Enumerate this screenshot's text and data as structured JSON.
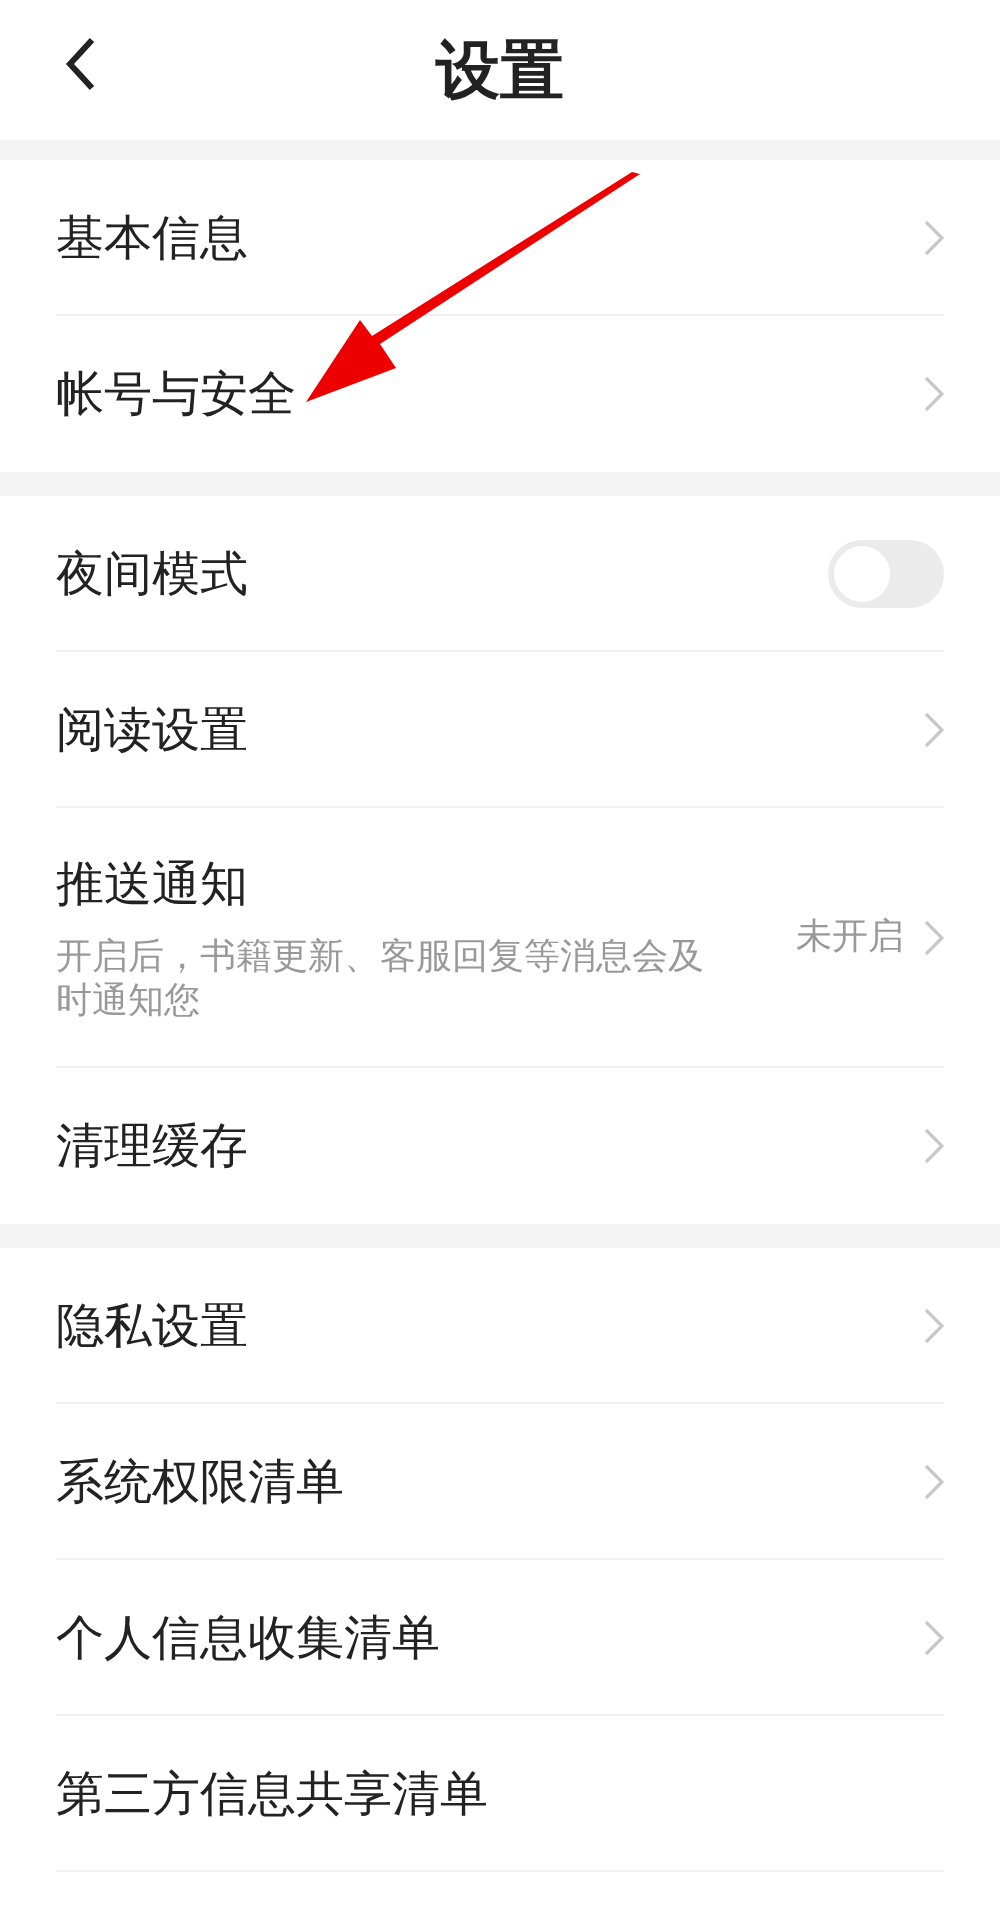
{
  "header": {
    "title": "设置"
  },
  "groups": [
    {
      "items": [
        {
          "kind": "link",
          "label": "基本信息",
          "chevron": true
        },
        {
          "kind": "link",
          "label": "帐号与安全",
          "chevron": true
        }
      ]
    },
    {
      "items": [
        {
          "kind": "toggle",
          "label": "夜间模式",
          "on": false
        },
        {
          "kind": "link",
          "label": "阅读设置",
          "chevron": true
        },
        {
          "kind": "detail",
          "label": "推送通知",
          "description": "开启后，书籍更新、客服回复等消息会及时通知您",
          "value": "未开启",
          "chevron": true
        },
        {
          "kind": "link",
          "label": "清理缓存",
          "chevron": true
        }
      ]
    },
    {
      "items": [
        {
          "kind": "link",
          "label": "隐私设置",
          "chevron": true
        },
        {
          "kind": "link",
          "label": "系统权限清单",
          "chevron": true
        },
        {
          "kind": "link",
          "label": "个人信息收集清单",
          "chevron": true
        },
        {
          "kind": "link",
          "label": "第三方信息共享清单",
          "chevron": false
        }
      ]
    }
  ]
}
